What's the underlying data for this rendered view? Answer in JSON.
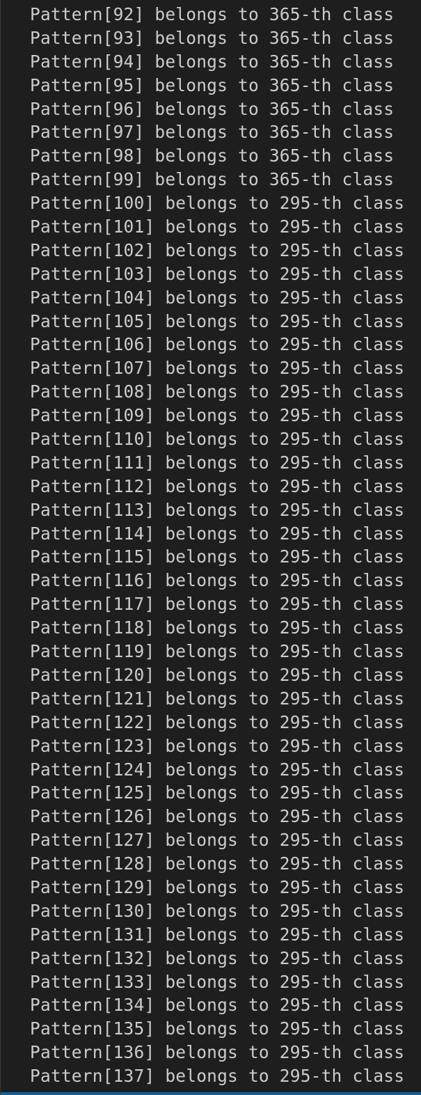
{
  "terminal": {
    "lines": [
      "Pattern[92] belongs to 365-th class",
      "Pattern[93] belongs to 365-th class",
      "Pattern[94] belongs to 365-th class",
      "Pattern[95] belongs to 365-th class",
      "Pattern[96] belongs to 365-th class",
      "Pattern[97] belongs to 365-th class",
      "Pattern[98] belongs to 365-th class",
      "Pattern[99] belongs to 365-th class",
      "Pattern[100] belongs to 295-th class",
      "Pattern[101] belongs to 295-th class",
      "Pattern[102] belongs to 295-th class",
      "Pattern[103] belongs to 295-th class",
      "Pattern[104] belongs to 295-th class",
      "Pattern[105] belongs to 295-th class",
      "Pattern[106] belongs to 295-th class",
      "Pattern[107] belongs to 295-th class",
      "Pattern[108] belongs to 295-th class",
      "Pattern[109] belongs to 295-th class",
      "Pattern[110] belongs to 295-th class",
      "Pattern[111] belongs to 295-th class",
      "Pattern[112] belongs to 295-th class",
      "Pattern[113] belongs to 295-th class",
      "Pattern[114] belongs to 295-th class",
      "Pattern[115] belongs to 295-th class",
      "Pattern[116] belongs to 295-th class",
      "Pattern[117] belongs to 295-th class",
      "Pattern[118] belongs to 295-th class",
      "Pattern[119] belongs to 295-th class",
      "Pattern[120] belongs to 295-th class",
      "Pattern[121] belongs to 295-th class",
      "Pattern[122] belongs to 295-th class",
      "Pattern[123] belongs to 295-th class",
      "Pattern[124] belongs to 295-th class",
      "Pattern[125] belongs to 295-th class",
      "Pattern[126] belongs to 295-th class",
      "Pattern[127] belongs to 295-th class",
      "Pattern[128] belongs to 295-th class",
      "Pattern[129] belongs to 295-th class",
      "Pattern[130] belongs to 295-th class",
      "Pattern[131] belongs to 295-th class",
      "Pattern[132] belongs to 295-th class",
      "Pattern[133] belongs to 295-th class",
      "Pattern[134] belongs to 295-th class",
      "Pattern[135] belongs to 295-th class",
      "Pattern[136] belongs to 295-th class",
      "Pattern[137] belongs to 295-th class"
    ]
  },
  "colors": {
    "background": "#1e1e1e",
    "text": "#cccccc",
    "accent_bar": "#0e639c"
  }
}
